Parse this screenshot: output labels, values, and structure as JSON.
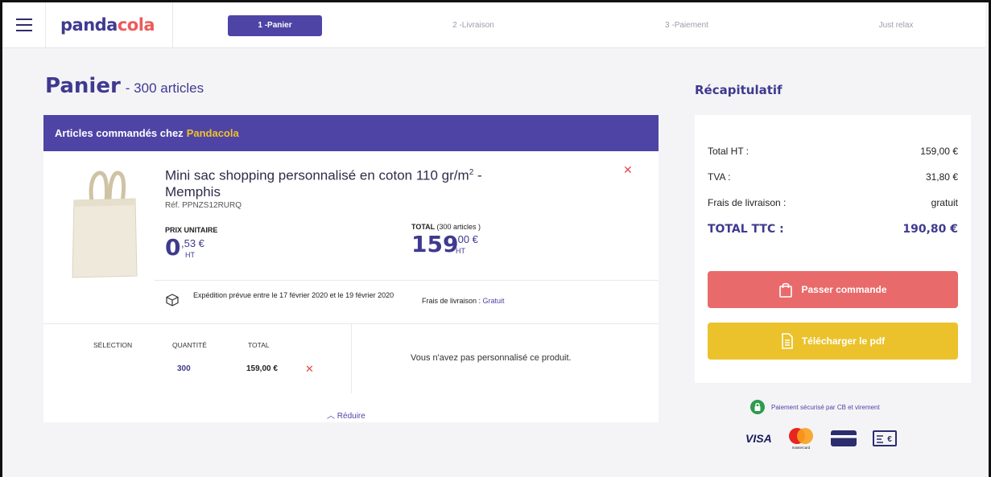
{
  "header": {
    "logo_part1": "panda",
    "logo_part2": "cola",
    "steps": [
      {
        "label": "1 -Panier"
      },
      {
        "label": "2 -Livraison"
      },
      {
        "label": "3 -Paiement"
      },
      {
        "label": "Just relax"
      }
    ]
  },
  "cart": {
    "title": "Panier",
    "count": "- 300 articles",
    "header_prefix": "Articles commandés chez",
    "header_brand": "Pandacola",
    "product": {
      "name_line1": "Mini sac shopping personnalisé en coton 110 gr/m",
      "name_sup": "2",
      "name_line1_suffix": " -",
      "name_line2": "Memphis",
      "ref": "Réf. PPNZS12RURQ",
      "unit_label": "PRIX UNITAIRE",
      "unit_int": "0",
      "unit_dec": ",53 €",
      "unit_ht": "HT",
      "total_label": "TOTAL",
      "total_count": "(300 articles )",
      "total_int": "159",
      "total_dec": ",00 €",
      "total_ht": "HT",
      "shipping_text": "Expédition prévue entre le 17 février 2020 et le 19 février 2020",
      "shipping_fee_label": "Frais de livraison :",
      "shipping_fee_value": "Gratuit"
    },
    "selection": {
      "col_selection": "SÉLECTION",
      "col_quantity": "QUANTITÉ",
      "col_total": "TOTAL",
      "quantity": "300",
      "total": "159,00 €",
      "no_custom": "Vous n'avez pas personnalisé ce produit.",
      "reduce": "Réduire"
    }
  },
  "summary": {
    "title": "Récapitulatif",
    "rows": [
      {
        "label": "Total HT :",
        "value": "159,00 €"
      },
      {
        "label": "TVA :",
        "value": "31,80 €"
      },
      {
        "label": "Frais de livraison :",
        "value": "gratuit"
      }
    ],
    "total_label": "TOTAL TTC :",
    "total_value": "190,80 €",
    "order_button": "Passer commande",
    "pdf_button": "Télécharger le pdf",
    "secure_text": "Paiement sécurisé par CB et virement",
    "visa": "VISA",
    "mastercard": "mastercard"
  },
  "colors": {
    "brand": "#4e44a5",
    "accent_red": "#e96a6a",
    "accent_yellow": "#ebc22b",
    "brand_orange": "#f0c12c"
  },
  "icons": [
    "menu-icon",
    "close-icon",
    "box-icon",
    "chevron-up-icon",
    "bag-icon",
    "document-icon",
    "lock-icon",
    "visa-icon",
    "mastercard-icon",
    "credit-card-icon",
    "bank-transfer-icon"
  ]
}
